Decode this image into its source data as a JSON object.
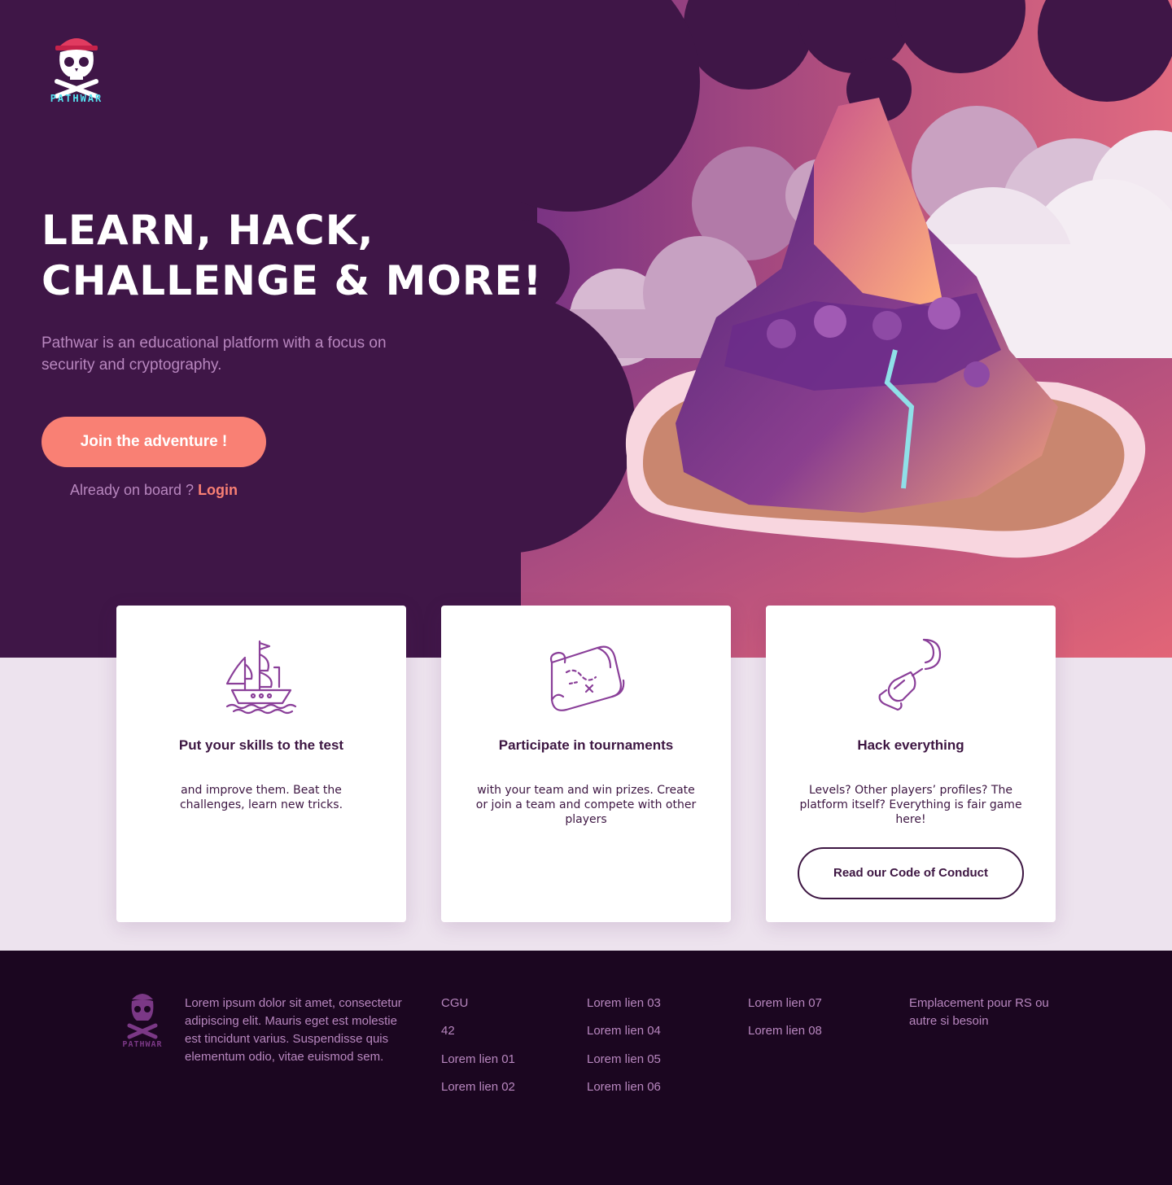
{
  "brand": {
    "name": "PATHWAR"
  },
  "hero": {
    "title_line1": "Learn, hack,",
    "title_line2": "challenge & more!",
    "subtitle": "Pathwar is an educational platform with a focus on security and cryptography.",
    "cta_label": "Join the adventure !",
    "login_prompt": "Already on board ?",
    "login_label": "Login"
  },
  "cards": [
    {
      "icon": "pirate-ship-icon",
      "title": "Put your skills to the test",
      "text": "and improve them. Beat the challenges, learn new tricks."
    },
    {
      "icon": "treasure-map-icon",
      "title": "Participate in tournaments",
      "text": "with your team and win prizes. Create or join a team and compete with other players"
    },
    {
      "icon": "pirate-hook-icon",
      "title": "Hack everything",
      "text": "Levels? Other players’ profiles? The platform itself? Everything is fair game here!",
      "button_label": "Read our Code of Conduct"
    }
  ],
  "footer": {
    "description": "Lorem ipsum dolor sit amet, consectetur adipiscing elit. Mauris eget est molestie est tincidunt varius. Suspendisse quis elementum odio, vitae euismod sem.",
    "columns": [
      [
        "CGU",
        "42",
        "Lorem lien 01",
        "Lorem lien 02"
      ],
      [
        "Lorem lien 03",
        "Lorem lien 04",
        "Lorem lien 05",
        "Lorem lien 06"
      ],
      [
        "Lorem lien 07",
        "Lorem lien 08"
      ]
    ],
    "social_placeholder": "Emplacement pour RS ou autre si besoin"
  },
  "colors": {
    "hero_bg": "#3f1647",
    "accent": "#f98074",
    "text_muted": "#b887bf",
    "card_text": "#3d1642",
    "features_bg": "#ede3ee",
    "footer_bg": "#1b0620",
    "logo_cyan": "#56e4f2"
  }
}
